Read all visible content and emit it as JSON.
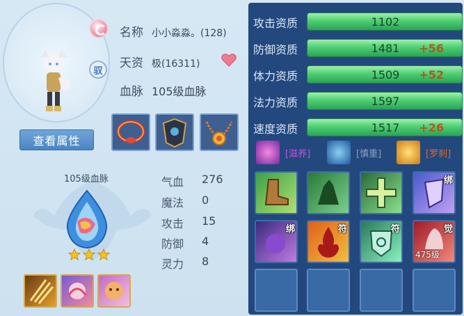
{
  "pet": {
    "name_label": "名称",
    "name_value": "小小淼淼。(128)",
    "talent_label": "天资",
    "talent_value": "极(16311)",
    "bloodline_label": "血脉",
    "bloodline_value": "105级血脉",
    "type_badge": "驭"
  },
  "buttons": {
    "view_attributes": "查看属性"
  },
  "bloodline_panel": {
    "title": "105级血脉",
    "stars": 3
  },
  "stats": [
    {
      "label": "气血",
      "value": "276"
    },
    {
      "label": "魔法",
      "value": "0"
    },
    {
      "label": "攻击",
      "value": "15"
    },
    {
      "label": "防御",
      "value": "4"
    },
    {
      "label": "灵力",
      "value": "8"
    }
  ],
  "aptitudes": [
    {
      "label": "攻击资质",
      "value": "1102",
      "bonus": ""
    },
    {
      "label": "防御资质",
      "value": "1481",
      "bonus": "+56"
    },
    {
      "label": "体力资质",
      "value": "1509",
      "bonus": "+52"
    },
    {
      "label": "法力资质",
      "value": "1597",
      "bonus": ""
    },
    {
      "label": "速度资质",
      "value": "1517",
      "bonus": "+26"
    }
  ],
  "traits": [
    {
      "label": "[滋养]",
      "color": "#c94fe0",
      "icon": "nourish-icon"
    },
    {
      "label": "[慎重]",
      "color": "#8fa2bf",
      "icon": "caution-icon"
    },
    {
      "label": "[罗刹]",
      "color": "#e06a2a",
      "icon": "rakshasa-icon"
    }
  ],
  "skill_tags": {
    "bound": "绑",
    "talisman": "符",
    "awaken": "觉",
    "awaken_level": "475级"
  },
  "colors": {
    "panel_bg": "#23487e",
    "bar_green": "#4fcf74",
    "bonus_orange": "#b1581e",
    "button_blue": "#4b86c4"
  }
}
